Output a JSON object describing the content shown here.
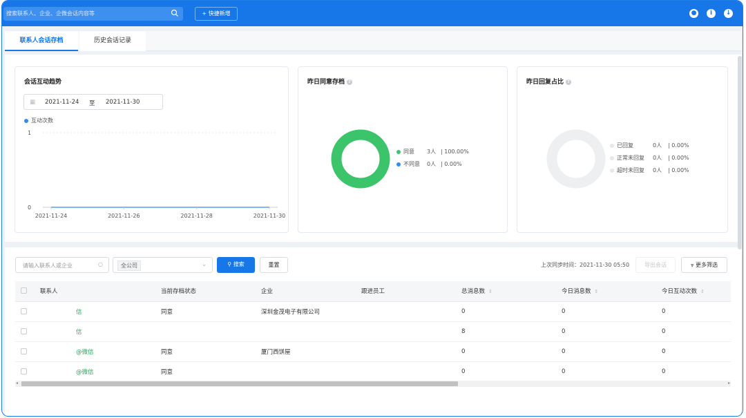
{
  "topbar": {
    "search_placeholder": "搜索联系人、企业、企微会话内容等",
    "quick_add": "+ 快捷新增"
  },
  "tabs": [
    {
      "label": "联系人会话存档"
    },
    {
      "label": "历史会话记录"
    }
  ],
  "trend_card": {
    "title": "会话互动趋势",
    "date_start": "2021-11-24",
    "date_sep": "至",
    "date_end": "2021-11-30",
    "legend": "互动次数",
    "y_ticks": [
      "1",
      "0"
    ],
    "x_ticks": [
      "2021-11-24",
      "2021-11-26",
      "2021-11-28",
      "2021-11-30"
    ]
  },
  "consent_card": {
    "title": "昨日同意存档",
    "items": [
      {
        "label": "同意",
        "count": "3人",
        "pct": "| 100.00%",
        "color": "#3cc46a"
      },
      {
        "label": "不同意",
        "count": "0人",
        "pct": "| 0.00%",
        "color": "#2f8cf0"
      }
    ]
  },
  "reply_card": {
    "title": "昨日回复占比",
    "items": [
      {
        "label": "已回复",
        "count": "0人",
        "pct": "| 0.00%"
      },
      {
        "label": "正常未回复",
        "count": "0人",
        "pct": "| 0.00%"
      },
      {
        "label": "超时未回复",
        "count": "0人",
        "pct": "| 0.00%"
      }
    ]
  },
  "chart_data": [
    {
      "type": "line",
      "title": "会话互动趋势",
      "series": [
        {
          "name": "互动次数",
          "values": [
            0,
            0,
            0,
            0,
            0,
            0,
            0
          ]
        }
      ],
      "x": [
        "2021-11-24",
        "2021-11-25",
        "2021-11-26",
        "2021-11-27",
        "2021-11-28",
        "2021-11-29",
        "2021-11-30"
      ],
      "ylim": [
        0,
        1
      ],
      "legend": "top-left"
    },
    {
      "type": "pie",
      "title": "昨日同意存档",
      "categories": [
        "同意",
        "不同意"
      ],
      "values": [
        3,
        0
      ]
    },
    {
      "type": "pie",
      "title": "昨日回复占比",
      "categories": [
        "已回复",
        "正常未回复",
        "超时未回复"
      ],
      "values": [
        0,
        0,
        0
      ]
    }
  ],
  "filters": {
    "contact_placeholder": "请输入联系人或企业",
    "company_select": "全公司",
    "search_btn": "搜索",
    "reset_btn": "重置",
    "sync_time": "上次同步时间：2021-11-30 05:50",
    "export_btn": "导出会话",
    "more_filter_btn": "更多筛选"
  },
  "table": {
    "headers": [
      "联系人",
      "当前存档状态",
      "企业",
      "跟进员工",
      "总消息数",
      "今日消息数",
      "今日互动次数"
    ],
    "rows": [
      [
        "信",
        "同意",
        "深圳金茂电子有限公司",
        "",
        "0",
        "0",
        "0"
      ],
      [
        "信",
        "",
        "",
        "",
        "8",
        "0",
        "0"
      ],
      [
        "@微信",
        "同意",
        "厦门西饼屋",
        "",
        "0",
        "0",
        "0"
      ],
      [
        "@微信",
        "同意",
        "",
        "",
        "0",
        "0",
        "0"
      ]
    ]
  }
}
